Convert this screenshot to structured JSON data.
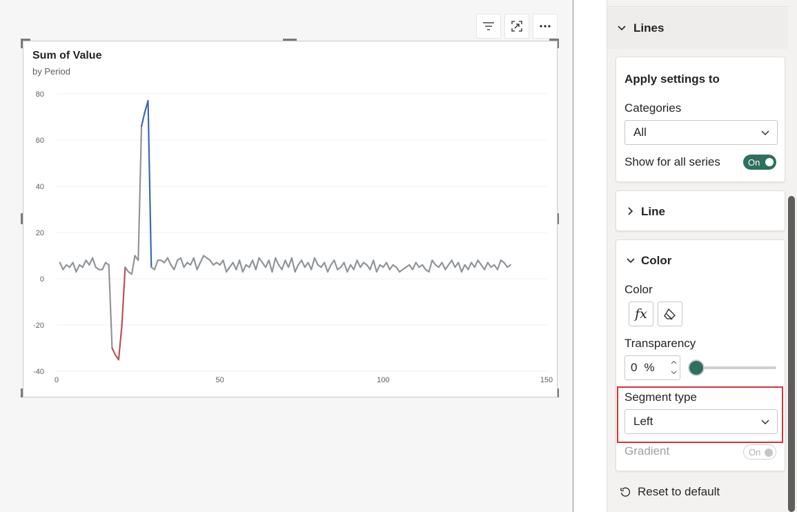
{
  "visual": {
    "title": "Sum of Value",
    "subtitle": "by Period",
    "header_buttons": [
      "filter-icon",
      "focus-mode-icon",
      "more-options-icon"
    ]
  },
  "chart_data": {
    "type": "line",
    "title": "Sum of Value",
    "subtitle": "by Period",
    "xlim": [
      0,
      150
    ],
    "ylim": [
      -40,
      80
    ],
    "x_ticks": [
      0,
      50,
      100,
      150
    ],
    "y_ticks": [
      80,
      60,
      40,
      20,
      0,
      -20,
      -40
    ],
    "grid": true,
    "colors": {
      "default": "#8f9499",
      "negative": "#b5525a",
      "positive": "#3d6aa8"
    },
    "series": [
      {
        "values": [
          7,
          4,
          6,
          5,
          7,
          3,
          6,
          5,
          8,
          6,
          9,
          5,
          4,
          4,
          7,
          6,
          -30,
          -33,
          -35,
          -20,
          5,
          3,
          2,
          10,
          8,
          66,
          72,
          77,
          5,
          4,
          8,
          8,
          7,
          9,
          6,
          4,
          8,
          9,
          5,
          7,
          6,
          9,
          4,
          7,
          10,
          9,
          8,
          6,
          7,
          6,
          8,
          3,
          5,
          7,
          4,
          8,
          3,
          6,
          5,
          8,
          4,
          9,
          7,
          5,
          8,
          3,
          9,
          6,
          4,
          8,
          5,
          9,
          3,
          6,
          8,
          5,
          7,
          4,
          9,
          6,
          5,
          7,
          3,
          6,
          8,
          4,
          5,
          7,
          3,
          6,
          4,
          8,
          5,
          7,
          6,
          4,
          8,
          3,
          6,
          5,
          7,
          4,
          6,
          5,
          3,
          4,
          5,
          6,
          4,
          7,
          5,
          6,
          4,
          3,
          8,
          6,
          5,
          7,
          4,
          6,
          8,
          5,
          7,
          3,
          6,
          4,
          7,
          5,
          8,
          6,
          4,
          7,
          5,
          6,
          4,
          8,
          7,
          5,
          6
        ]
      }
    ]
  },
  "pane": {
    "section_title": "Lines",
    "apply": {
      "title": "Apply settings to",
      "categories_label": "Categories",
      "categories_value": "All",
      "show_all_label": "Show for all series",
      "show_all_toggle": "On"
    },
    "line": {
      "title": "Line"
    },
    "color": {
      "title": "Color",
      "color_label": "Color",
      "fx_label": "fx",
      "transparency_label": "Transparency",
      "transparency_value": "0",
      "transparency_unit": "%",
      "transparency_level": 0,
      "segment_label": "Segment type",
      "segment_value": "Left",
      "gradient_label": "Gradient",
      "gradient_toggle": "On"
    },
    "reset_label": "Reset to default",
    "accent": "#2f6f5f"
  }
}
